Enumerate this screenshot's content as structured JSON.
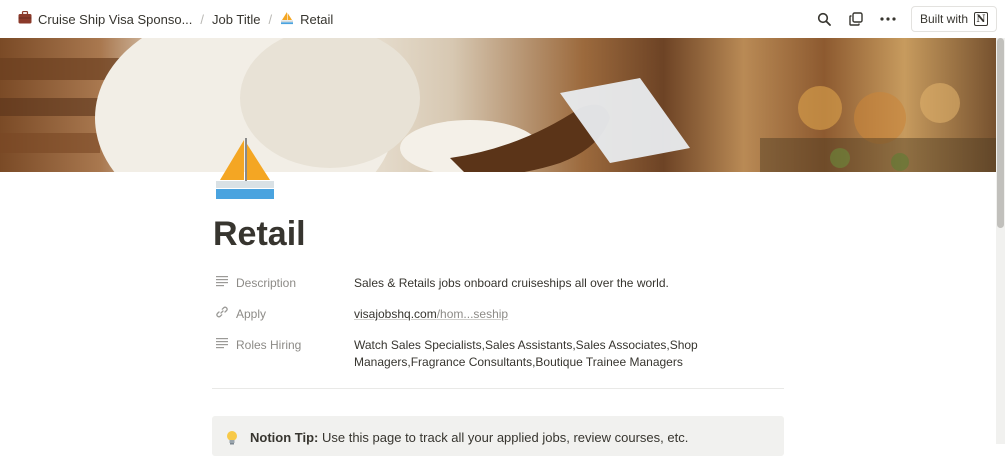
{
  "breadcrumb": {
    "items": [
      {
        "label": "Cruise Ship Visa Sponso...",
        "icon": "briefcase-icon"
      },
      {
        "label": "Job Title",
        "icon": ""
      },
      {
        "label": "Retail",
        "icon": "sailboat-icon"
      }
    ],
    "separator": "/"
  },
  "topbar": {
    "icons": [
      "search-icon",
      "duplicate-icon",
      "more-icon"
    ],
    "built_with_label": "Built with",
    "built_with_logo": "N"
  },
  "page": {
    "title": "Retail",
    "icon": "sailboat-icon"
  },
  "properties": [
    {
      "name": "Description",
      "icon": "text-lines-icon",
      "value": "Sales & Retails jobs onboard cruiseships all over the world."
    },
    {
      "name": "Apply",
      "icon": "link-icon",
      "url_main": "visajobshq.com",
      "url_rest": "/hom...seship"
    },
    {
      "name": "Roles Hiring",
      "icon": "text-lines-icon",
      "value": "Watch Sales Specialists,Sales Assistants,Sales Associates,Shop Managers,Fragrance Consultants,Boutique Trainee Managers"
    }
  ],
  "callout": {
    "icon": "lightbulb-icon",
    "bold": "Notion Tip:",
    "text": " Use this page to track all your applied jobs, review courses, etc."
  },
  "colors": {
    "text": "#37352f",
    "muted": "#8d8b87",
    "callout_bg": "#f1f1ef"
  }
}
